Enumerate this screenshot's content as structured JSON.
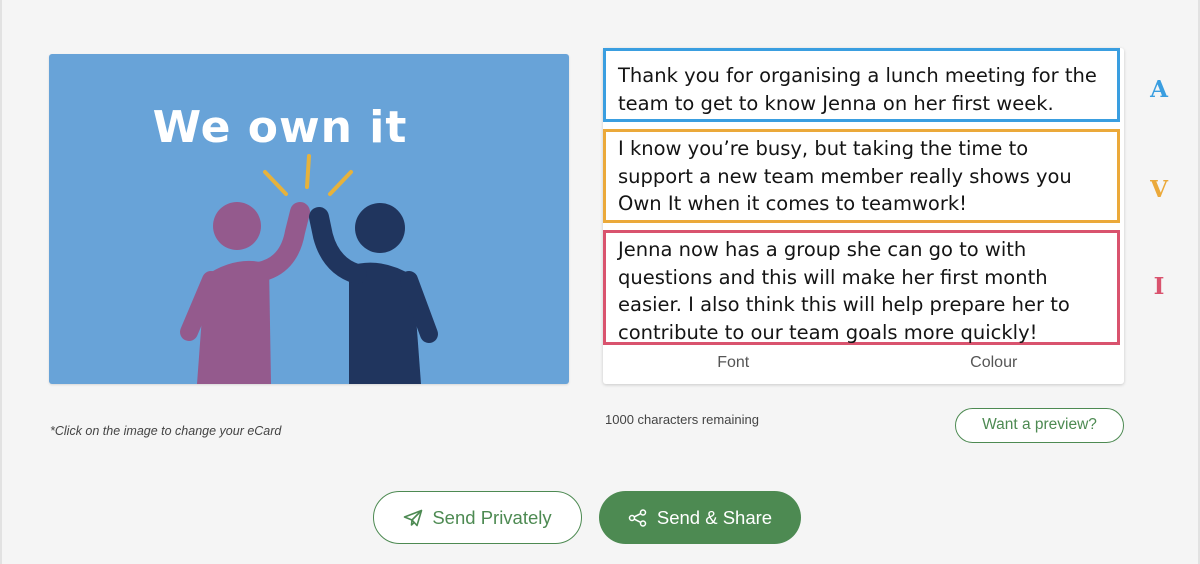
{
  "ecard": {
    "title": "We own it",
    "hint": "*Click on the image to change your eCard"
  },
  "messages": [
    {
      "letter": "A",
      "text": "Thank you for organising a lunch meeting for the team to get to know Jenna on her first week.",
      "color": "#3a9ee0"
    },
    {
      "letter": "V",
      "text": "I know you’re busy, but taking the time to support a new team member really shows you Own It when it comes to teamwork!",
      "color": "#eba93a"
    },
    {
      "letter": "I",
      "text": "Jenna now has a group she can go to with questions and this will make her first month easier. I also think this will help prepare her to contribute to our team goals more quickly!",
      "color": "#d9536e"
    }
  ],
  "toolbar": {
    "font_label": "Font",
    "colour_label": "Colour"
  },
  "chars_remaining": "1000 characters remaining",
  "preview_label": "Want a preview?",
  "actions": {
    "send_private_label": "Send Privately",
    "send_share_label": "Send & Share",
    "send_private_icon": "paper-plane-icon",
    "send_share_icon": "share-icon"
  },
  "colors": {
    "brand_green": "#4d8a52",
    "card_blue": "#68a3d8",
    "figure_purple": "#945a8d",
    "figure_navy": "#20355e",
    "spark_yellow": "#e6b23c"
  }
}
